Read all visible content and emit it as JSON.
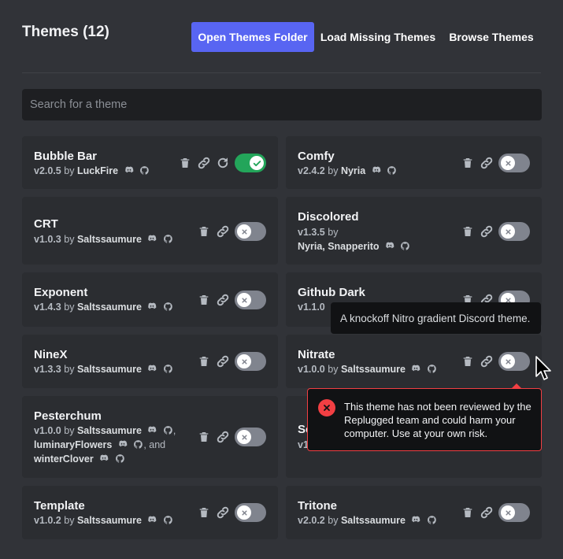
{
  "header": {
    "title": "Themes (12)",
    "open_folder_label": "Open Themes Folder",
    "load_missing_label": "Load Missing Themes",
    "browse_label": "Browse Themes"
  },
  "search": {
    "placeholder": "Search for a theme",
    "value": ""
  },
  "colors": {
    "background": "#313338",
    "card": "#2b2d31",
    "primary": "#5865f2",
    "toggle_on": "#23a55a",
    "toggle_off": "#80848e",
    "danger": "#f23f43"
  },
  "themes": [
    {
      "name": "Bubble Bar",
      "version": "v2.0.5",
      "by": "by",
      "authors": "LuckFire",
      "enabled": true
    },
    {
      "name": "Comfy",
      "version": "v2.4.2",
      "by": "by",
      "authors": "Nyria",
      "enabled": false
    },
    {
      "name": "CRT",
      "version": "v1.0.3",
      "by": "by",
      "authors": "Saltssaumure",
      "enabled": false
    },
    {
      "name": "Discolored",
      "version": "v1.3.5",
      "by": "by",
      "authors": "Nyria, Snapperito",
      "enabled": false
    },
    {
      "name": "Exponent",
      "version": "v1.4.3",
      "by": "by",
      "authors": "Saltssaumure",
      "enabled": false
    },
    {
      "name": "Github Dark",
      "version": "v1.1.0",
      "by": "by",
      "authors": "",
      "enabled": false
    },
    {
      "name": "NineX",
      "version": "v1.3.3",
      "by": "by",
      "authors": "Saltssaumure",
      "enabled": false
    },
    {
      "name": "Nitrate",
      "version": "v1.0.0",
      "by": "by",
      "authors": "Saltssaumure",
      "enabled": false
    },
    {
      "name": "Pesterchum",
      "version": "v1.0.0",
      "by": "by",
      "author_1": "Saltssaumure",
      "author_2": "luminaryFlowers",
      "and": ", and",
      "author_3": "winterClover",
      "enabled": false
    },
    {
      "name": "Sc",
      "version": "v1",
      "enabled": false
    },
    {
      "name": "Template",
      "version": "v1.0.2",
      "by": "by",
      "authors": "Saltssaumure",
      "enabled": false
    },
    {
      "name": "Tritone",
      "version": "v2.0.2",
      "by": "by",
      "authors": "Saltssaumure",
      "enabled": false
    }
  ],
  "tooltip": {
    "text": "A knockoff Nitro gradient Discord theme."
  },
  "warning": {
    "text": "This theme has not been reviewed by the Replugged team and could harm your computer. Use at your own risk."
  },
  "icons": {
    "delete": "trash-icon",
    "link": "link-icon",
    "reload": "reload-icon",
    "discord": "discord-icon",
    "github": "github-icon",
    "toggle_off": "x-icon",
    "toggle_on": "check-icon"
  }
}
